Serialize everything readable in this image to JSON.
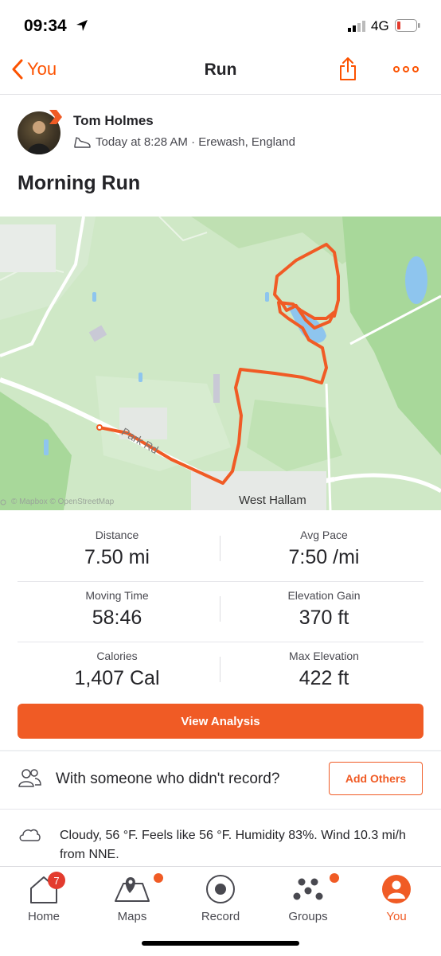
{
  "status_bar": {
    "time": "09:34",
    "network": "4G"
  },
  "nav": {
    "back_label": "You",
    "title": "Run"
  },
  "athlete": {
    "name": "Tom Holmes",
    "meta": "Today at 8:28 AM · Erewash, England"
  },
  "activity": {
    "title": "Morning Run"
  },
  "map": {
    "place_label": "West Hallam",
    "road_label": "Park Rd",
    "credit": "© Mapbox © OpenStreetMap"
  },
  "stats": [
    {
      "left": {
        "label": "Distance",
        "value": "7.50 mi"
      },
      "right": {
        "label": "Avg Pace",
        "value": "7:50 /mi"
      }
    },
    {
      "left": {
        "label": "Moving Time",
        "value": "58:46"
      },
      "right": {
        "label": "Elevation Gain",
        "value": "370 ft"
      }
    },
    {
      "left": {
        "label": "Calories",
        "value": "1,407 Cal"
      },
      "right": {
        "label": "Max Elevation",
        "value": "422 ft"
      }
    }
  ],
  "buttons": {
    "view_analysis": "View Analysis",
    "add_others": "Add Others"
  },
  "with_someone": {
    "text": "With someone who didn't record?"
  },
  "weather": {
    "text": "Cloudy, 56 °F. Feels like 56 °F. Humidity 83%. Wind 10.3 mi/h from NNE."
  },
  "tabbar": {
    "items": [
      {
        "label": "Home",
        "badge": "7"
      },
      {
        "label": "Maps"
      },
      {
        "label": "Record"
      },
      {
        "label": "Groups"
      },
      {
        "label": "You"
      }
    ]
  },
  "colors": {
    "accent": "#f05b25",
    "badge": "#e33b2e",
    "map_green": "#cfe8c6",
    "route": "#f05b25"
  }
}
